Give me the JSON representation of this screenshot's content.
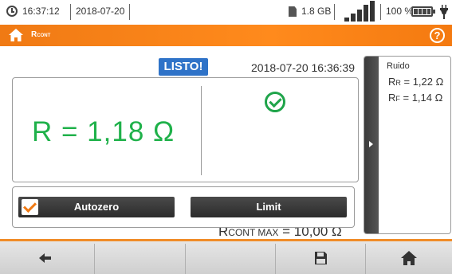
{
  "status": {
    "time": "16:37:12",
    "date": "2018-07-20",
    "icons": [
      "clock-icon",
      "memory-card-icon",
      "signal-strength-icon",
      "battery-icon",
      "power-plug-icon"
    ],
    "memory": "1.8 GB",
    "battery_percent": "100 %"
  },
  "header": {
    "title_main": "R",
    "title_sub": "CONT",
    "icons": [
      "home-icon",
      "help-icon"
    ],
    "help_label": "?"
  },
  "result": {
    "status_badge": "LISTO!",
    "timestamp": "2018-07-20 16:36:39",
    "main_value": "R = 1,18 Ω",
    "pass_icon": "check-circle-icon",
    "limit_symbol": "R",
    "limit_sub": "CONT MAX",
    "limit_value": " = 10,00 Ω"
  },
  "side_panel": {
    "title": "Ruido",
    "rr_symbol": "R",
    "rr_sub": "R",
    "rr_value": " = 1,22 Ω",
    "rf_symbol": "R",
    "rf_sub": "F",
    "rf_value": " = 1,14 Ω"
  },
  "buttons": {
    "autozero_label": "Autozero",
    "autozero_checked": true,
    "limit_label": "Limit"
  },
  "toolbar": {
    "icons": [
      "back-arrow-icon",
      "save-icon",
      "home-icon"
    ]
  },
  "colors": {
    "accent": "#f07a14",
    "result_green": "#1fb14a",
    "badge_blue": "#2f73c8"
  }
}
